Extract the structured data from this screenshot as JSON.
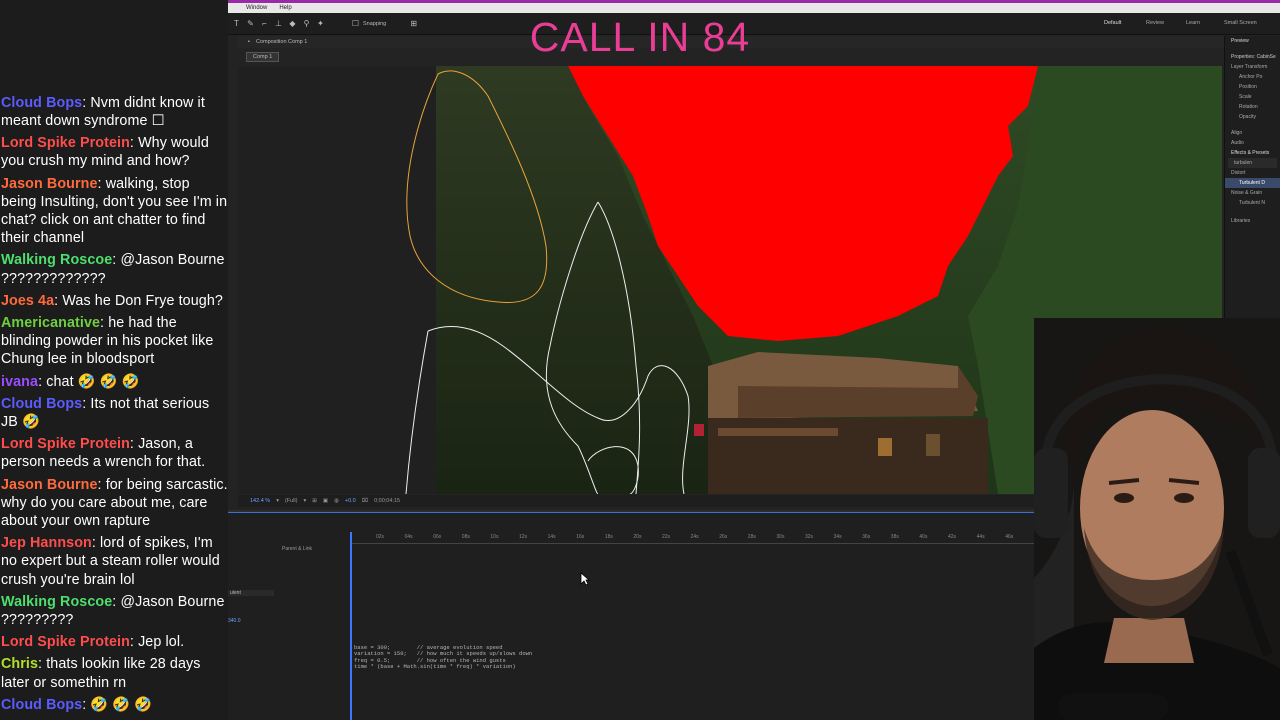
{
  "overlay": {
    "banner": "CALL IN 84"
  },
  "chat": {
    "messages": [
      {
        "user": "Cloud Bops",
        "color": "#5b5bff",
        "text": "Nvm didnt know it meant down syndrome ☐"
      },
      {
        "user": "Lord Spike Protein",
        "color": "#ff4d4d",
        "text": "Why would you crush my mind and how?"
      },
      {
        "user": "Jason Bourne",
        "color": "#ff6a3d",
        "text": "walking, stop being Insulting, don't you see I'm in chat? click on ant chatter to find their channel"
      },
      {
        "user": "Walking Roscoe",
        "color": "#4ddf6e",
        "text": "@Jason Bourne ?????????????"
      },
      {
        "user": "Joes 4a",
        "color": "#ff6a3d",
        "text": "Was he Don Frye tough?"
      },
      {
        "user": "Americanative",
        "color": "#6fcf3f",
        "text": "he had the blinding powder in his pocket like Chung lee in bloodsport"
      },
      {
        "user": "ivana",
        "color": "#9a4dff",
        "text": "chat 🤣 🤣 🤣"
      },
      {
        "user": "Cloud Bops",
        "color": "#5b5bff",
        "text": "Its not that serious JB 🤣"
      },
      {
        "user": "Lord Spike Protein",
        "color": "#ff4d4d",
        "text": "Jason, a person needs a wrench for that."
      },
      {
        "user": "Jason Bourne",
        "color": "#ff6a3d",
        "text": "for being sarcastic. why do you care about me, care about your own rapture"
      },
      {
        "user": "Jep Hannson",
        "color": "#ff4d4d",
        "text": "lord of spikes, I'm no expert but a steam roller would crush you're brain lol"
      },
      {
        "user": "Walking Roscoe",
        "color": "#4ddf6e",
        "text": "@Jason Bourne ?????????"
      },
      {
        "user": "Lord Spike Protein",
        "color": "#ff4d4d",
        "text": "Jep lol."
      },
      {
        "user": "Chris",
        "color": "#b0e02a",
        "text": "thats lookin like 28 days later or somethin rn"
      },
      {
        "user": "Cloud Bops",
        "color": "#5b5bff",
        "text": "🤣 🤣 🤣"
      }
    ]
  },
  "ae": {
    "menu": [
      "",
      "Window",
      "Help"
    ],
    "toolbar": {
      "snapping": "Snapping"
    },
    "workspaces": [
      "Default",
      "Review",
      "Learn",
      "Small Screen"
    ],
    "composition": {
      "header": "Composition Comp 1",
      "tab": "Comp 1"
    },
    "viewer_bar": {
      "zoom": "142.4 %",
      "resolution": "(Full)",
      "offset": "+0.0",
      "timecode": "0;00;04;15"
    },
    "timeline": {
      "parent_label": "Parent & Link",
      "ticks": [
        "02s",
        "04s",
        "06s",
        "08s",
        "10s",
        "12s",
        "14s",
        "16s",
        "18s",
        "20s",
        "22s",
        "24s",
        "26s",
        "28s",
        "30s",
        "32s",
        "34s",
        "36s",
        "38s",
        "40s",
        "42s",
        "44s",
        "46s"
      ],
      "layer_name": "ulent",
      "value": "340.0",
      "expression": "base = 300;        // average evolution speed\nvariation = 150;   // how much it speeds up/slows down\nfreq = 0.5;        // how often the wind gusts\ntime * (base + Math.sin(time * freq) * variation)"
    },
    "right_panel": {
      "preview": "Preview",
      "properties": "Properties: CabinSe",
      "layer_transform": "Layer Transform",
      "props": [
        "Anchor Po",
        "Position",
        "Scale",
        "Rotation",
        "Opacity"
      ],
      "align": "Align",
      "audio": "Audio",
      "effects": "Effects & Presets",
      "search": "turbulen",
      "distort": "Distort",
      "turb_disp": "Turbulent D",
      "noise": "Noise & Grain",
      "turb_noise": "Turbulent N",
      "libraries": "Libraries"
    }
  }
}
